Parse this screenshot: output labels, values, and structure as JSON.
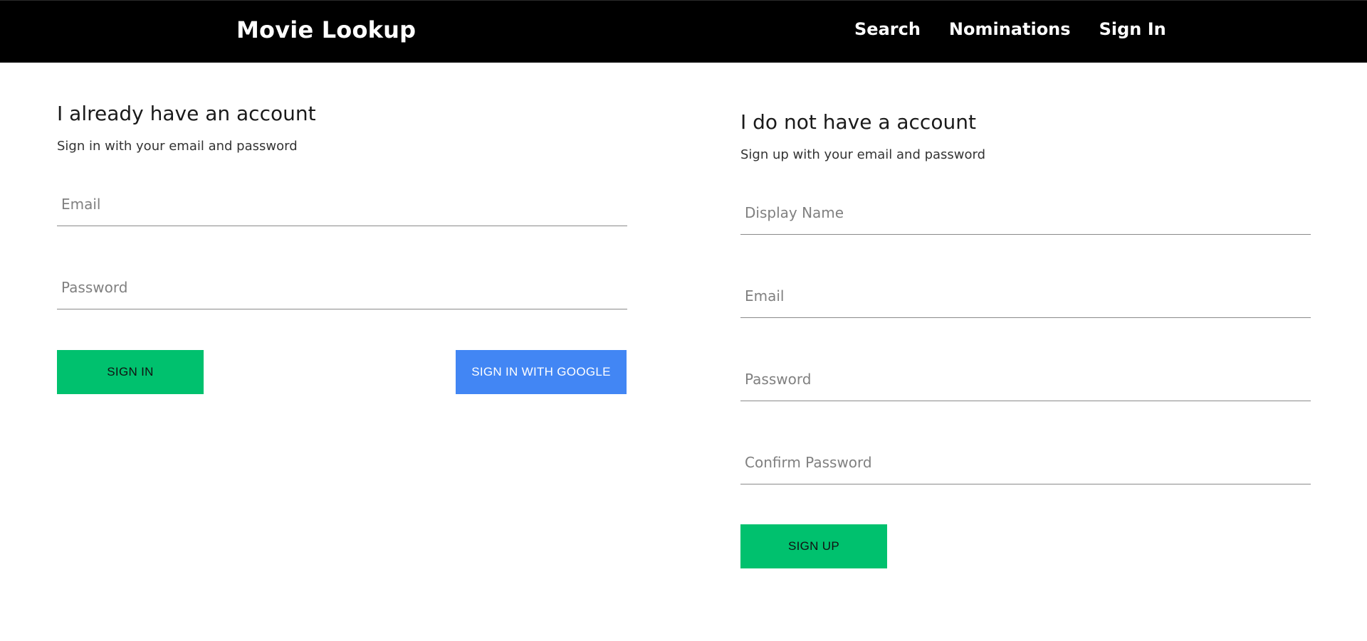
{
  "header": {
    "brand": "Movie Lookup",
    "nav": [
      {
        "label": "Search"
      },
      {
        "label": "Nominations"
      },
      {
        "label": "Sign In"
      }
    ]
  },
  "sign_in": {
    "title": "I already have an account",
    "subtitle": "Sign in with your email and password",
    "email_placeholder": "Email",
    "email_value": "",
    "password_placeholder": "Password",
    "password_value": "",
    "submit_label": "Sign In",
    "google_label": "Sign In With Google"
  },
  "sign_up": {
    "title": "I do not have a account",
    "subtitle": "Sign up with your email and password",
    "display_name_placeholder": "Display Name",
    "display_name_value": "",
    "email_placeholder": "Email",
    "email_value": "",
    "password_placeholder": "Password",
    "password_value": "",
    "confirm_password_placeholder": "Confirm Password",
    "confirm_password_value": "",
    "submit_label": "Sign Up"
  },
  "colors": {
    "header_bg": "#000000",
    "primary_button": "#00c16e",
    "google_button": "#4286f4",
    "input_underline": "#8a8a8a"
  }
}
